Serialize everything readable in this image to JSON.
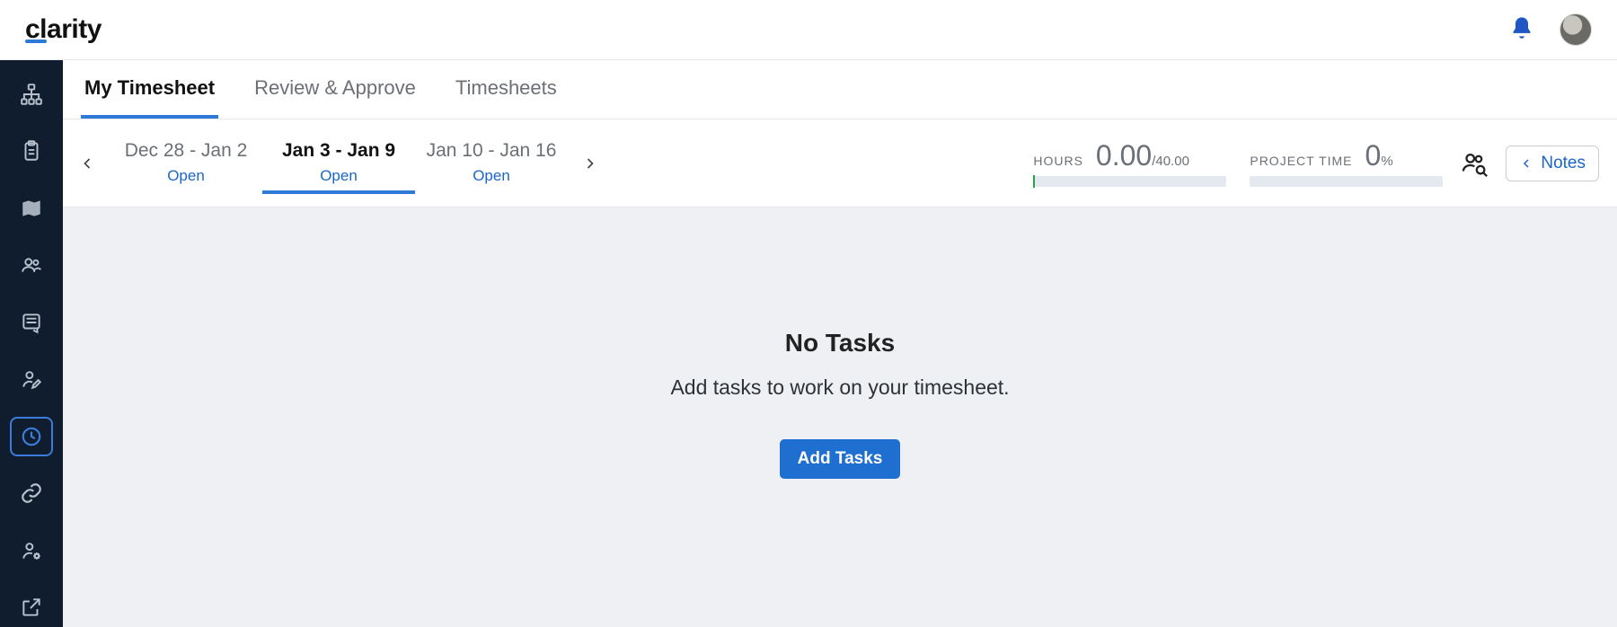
{
  "app": {
    "name": "clarity"
  },
  "tabs": [
    {
      "label": "My Timesheet",
      "active": true
    },
    {
      "label": "Review & Approve",
      "active": false
    },
    {
      "label": "Timesheets",
      "active": false
    }
  ],
  "periods": [
    {
      "range": "Dec 28 - Jan 2",
      "status": "Open",
      "active": false
    },
    {
      "range": "Jan 3 - Jan 9",
      "status": "Open",
      "active": true
    },
    {
      "range": "Jan 10 - Jan 16",
      "status": "Open",
      "active": false
    }
  ],
  "stats": {
    "hours": {
      "label": "HOURS",
      "value": "0.00",
      "suffix": "/40.00"
    },
    "project_time": {
      "label": "PROJECT TIME",
      "value": "0",
      "suffix": "%"
    }
  },
  "notes_button": "Notes",
  "empty_state": {
    "title": "No Tasks",
    "subtitle": "Add tasks to work on your timesheet.",
    "button": "Add Tasks"
  },
  "sidebar_icons": [
    "sitemap-icon",
    "clipboard-icon",
    "map-icon",
    "people-icon",
    "form-icon",
    "edit-user-icon",
    "clock-icon",
    "link-icon",
    "user-settings-icon",
    "external-link-icon"
  ],
  "sidebar_active_index": 6
}
